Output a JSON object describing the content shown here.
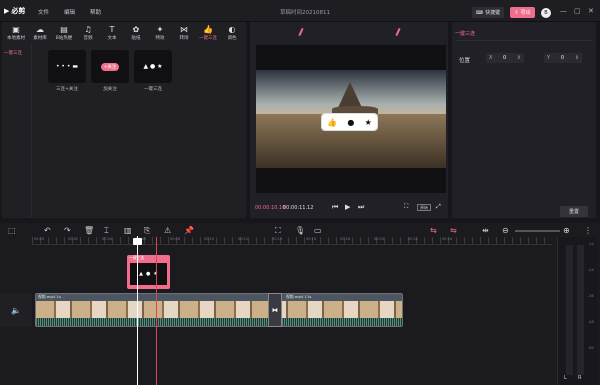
{
  "app": {
    "logo_text": "必剪",
    "menus": [
      "文件",
      "编辑",
      "帮助"
    ],
    "title": "草稿时间20210811",
    "shortcut_label": "快捷键",
    "export_label": "导出",
    "avatar_text": "B",
    "window_controls": [
      "—",
      "▢",
      "✕"
    ]
  },
  "library": {
    "tools": [
      {
        "label": "本地素材",
        "icon": "▣"
      },
      {
        "label": "素材库",
        "icon": "☁"
      },
      {
        "label": "B站热梗",
        "icon": "▤"
      },
      {
        "label": "音频",
        "icon": "♫"
      },
      {
        "label": "文本",
        "icon": "T"
      },
      {
        "label": "贴纸",
        "icon": "✿"
      },
      {
        "label": "特效",
        "icon": "✦"
      },
      {
        "label": "转场",
        "icon": "⋈"
      },
      {
        "label": "一键三连",
        "icon": "👍",
        "active": true
      },
      {
        "label": "调色",
        "icon": "◐"
      }
    ],
    "category": "一键三连",
    "cards": [
      {
        "label": "三连+关注",
        "content": "• • • ▬"
      },
      {
        "label": "加关注",
        "content": "+关注"
      },
      {
        "label": "一键三连",
        "content": "▲ ● ★"
      }
    ]
  },
  "preview": {
    "current_time": "00:00:10.10",
    "total_time": "00:00:11.12",
    "fit_label": "原始",
    "sticker_icons": [
      "👍",
      "●",
      "★"
    ]
  },
  "properties": {
    "tab": "一键三连",
    "position_label": "位置",
    "x_label": "X",
    "x_value": "0",
    "y_label": "Y",
    "y_value": "0",
    "reset_label": "重置"
  },
  "timeline": {
    "ruler_ticks": [
      "00:00",
      "00:02",
      "00:04",
      "00:06",
      "00:08",
      "00:10",
      "00:12",
      "00:14",
      "00:16",
      "00:18",
      "00:20",
      "00:22",
      "00:24"
    ],
    "sticker_clip_label": "一键三连",
    "video_clip_label": "视频.mp4   1s",
    "video_clip2_label": "视频.mp4   11s",
    "meter_labels": [
      "L",
      "R"
    ],
    "meter_scale": [
      "-12",
      "-24",
      "-36",
      "-48",
      "-60"
    ]
  },
  "colors": {
    "accent": "#f16d8c",
    "bg": "#17171b",
    "panel": "#1f1f24"
  }
}
